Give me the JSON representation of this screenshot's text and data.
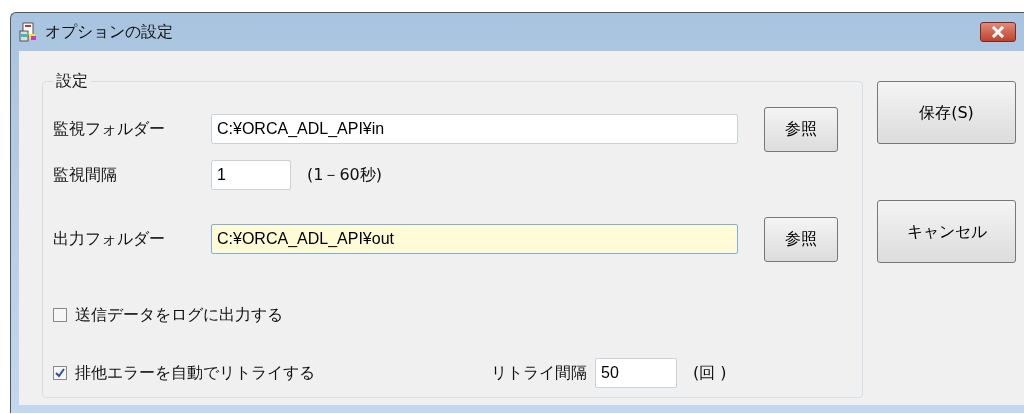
{
  "window": {
    "title": "オプションの設定"
  },
  "group": {
    "title": "設定",
    "rows": [
      {
        "kind": "folder",
        "label": "監視フォルダー",
        "value": "C:¥ORCA_ADL_API¥in",
        "highlighted": false,
        "button": "参照"
      },
      {
        "kind": "interval",
        "label": "監視間隔",
        "value": "1",
        "note": "(1－60秒)"
      },
      {
        "kind": "folder",
        "label": "出力フォルダー",
        "value": "C:¥ORCA_ADL_API¥out",
        "highlighted": true,
        "button": "参照"
      }
    ],
    "options": [
      {
        "label": "送信データをログに出力する",
        "checked": false
      },
      {
        "label": "排他エラーを自動でリトライする",
        "checked": true,
        "extra_label": "リトライ間隔",
        "extra_value": "50",
        "extra_note": "(回 )"
      }
    ]
  },
  "buttons": [
    "保存(S)",
    "キャンセル"
  ]
}
